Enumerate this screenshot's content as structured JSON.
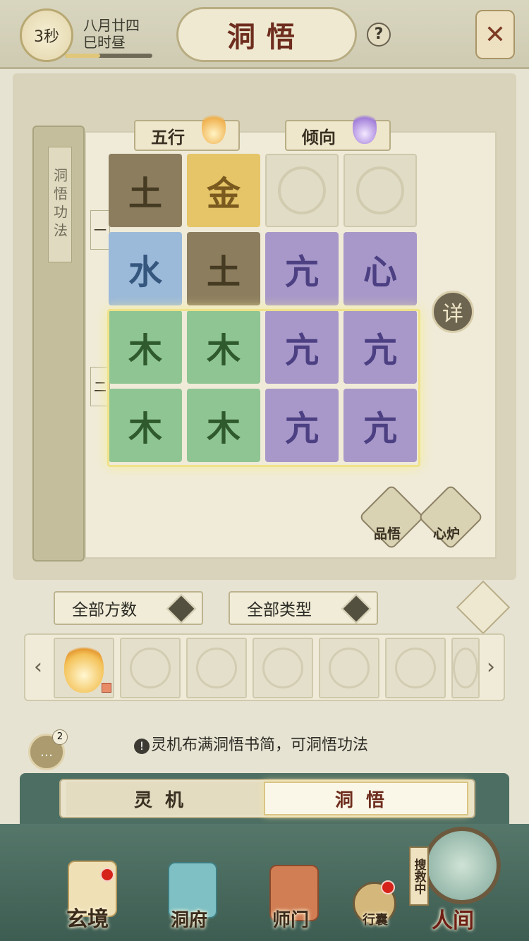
{
  "header": {
    "timer": "3秒",
    "date_line1": "八月廿四",
    "date_line2": "巳时昼",
    "day_progress": 0.4,
    "title": "洞悟",
    "help_label": "?"
  },
  "book": {
    "spine_label": "洞悟功法",
    "tab_wuxing": "五行",
    "tab_qingxiang": "倾向",
    "row1_mark": "一",
    "row2_mark": "二",
    "grid": [
      [
        {
          "glyph": "土",
          "type": "earth"
        },
        {
          "glyph": "金",
          "type": "metal"
        },
        {
          "glyph": "",
          "type": "empty"
        },
        {
          "glyph": "",
          "type": "empty"
        }
      ],
      [
        {
          "glyph": "水",
          "type": "water"
        },
        {
          "glyph": "土",
          "type": "earth"
        },
        {
          "glyph": "亢",
          "type": "spirit"
        },
        {
          "glyph": "心",
          "type": "spirit"
        }
      ],
      [
        {
          "glyph": "木",
          "type": "wood"
        },
        {
          "glyph": "木",
          "type": "wood"
        },
        {
          "glyph": "亢",
          "type": "spirit"
        },
        {
          "glyph": "亢",
          "type": "spirit"
        }
      ],
      [
        {
          "glyph": "木",
          "type": "wood"
        },
        {
          "glyph": "木",
          "type": "wood"
        },
        {
          "glyph": "亢",
          "type": "spirit"
        },
        {
          "glyph": "亢",
          "type": "spirit"
        }
      ]
    ],
    "detail_button": "详",
    "pinwu_label": "品悟",
    "xinlu_label": "心炉"
  },
  "filters": {
    "count_filter": "全部方数",
    "type_filter": "全部类型"
  },
  "tray": {
    "arrow_left": "‹",
    "arrow_right": "›",
    "slots": [
      "fire",
      "empty",
      "empty",
      "empty",
      "empty",
      "empty",
      "empty"
    ]
  },
  "hint": {
    "chat_badge": "2",
    "chat_icon": "…",
    "mark": "!",
    "text": "灵机布满洞悟书简，可洞悟功法"
  },
  "mode_tabs": {
    "lingji": "灵机",
    "dongwu": "洞悟",
    "active": "dongwu"
  },
  "nav": {
    "xuanjing": "玄境",
    "dongfu": "洞府",
    "shimen": "师门",
    "xingnang": "行囊",
    "renjian": "人间",
    "rescue": "搜救中"
  }
}
